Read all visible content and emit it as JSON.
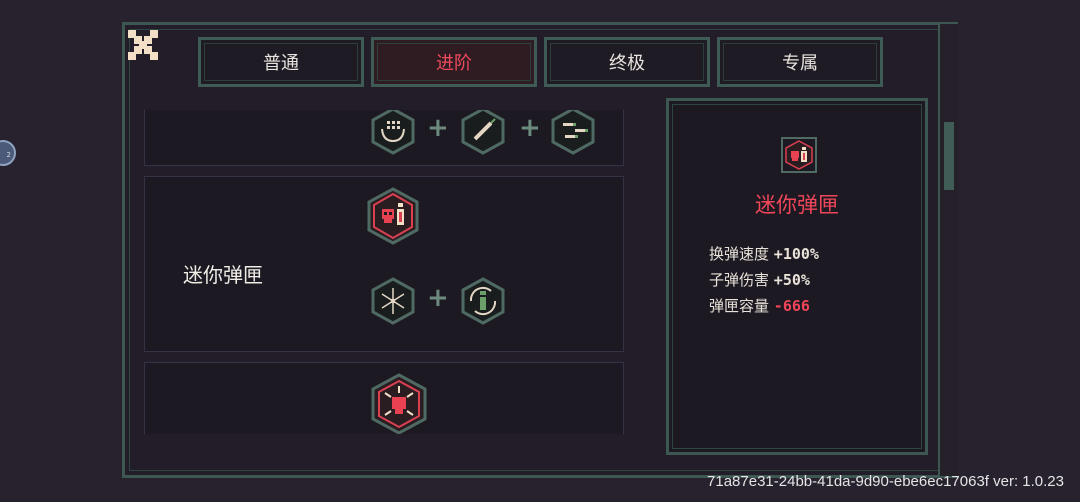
{
  "tabs": [
    {
      "label": "普通",
      "active": false
    },
    {
      "label": "进阶",
      "active": true
    },
    {
      "label": "终极",
      "active": false
    },
    {
      "label": "专属",
      "active": false
    }
  ],
  "list": {
    "rows": [
      {
        "label": "",
        "icons": [
          "grid-cycle-icon",
          "syringe-icon",
          "bullets-icon"
        ]
      },
      {
        "label": "迷你弹匣",
        "result_icon": "skull-ammo-icon",
        "icons": [
          "spread-shot-icon",
          "reload-ammo-icon"
        ]
      },
      {
        "label": "",
        "result_icon": "skull-burst-icon",
        "icons": []
      }
    ]
  },
  "detail": {
    "icon": "skull-ammo-icon",
    "title": "迷你弹匣",
    "stats": [
      {
        "label": "换弹速度",
        "value": "+100%",
        "negative": false
      },
      {
        "label": "子弹伤害",
        "value": "+50%",
        "negative": false
      },
      {
        "label": "弹匣容量",
        "value": "-666",
        "negative": true
      }
    ]
  },
  "version_text": "71a87e31-24bb-41da-9d90-ebe6ec17063f ver: 1.0.23",
  "colors": {
    "background": "#27222e",
    "panel_border": "#3d5752",
    "accent_red": "#ef4659",
    "text_light": "#f0ece6"
  }
}
